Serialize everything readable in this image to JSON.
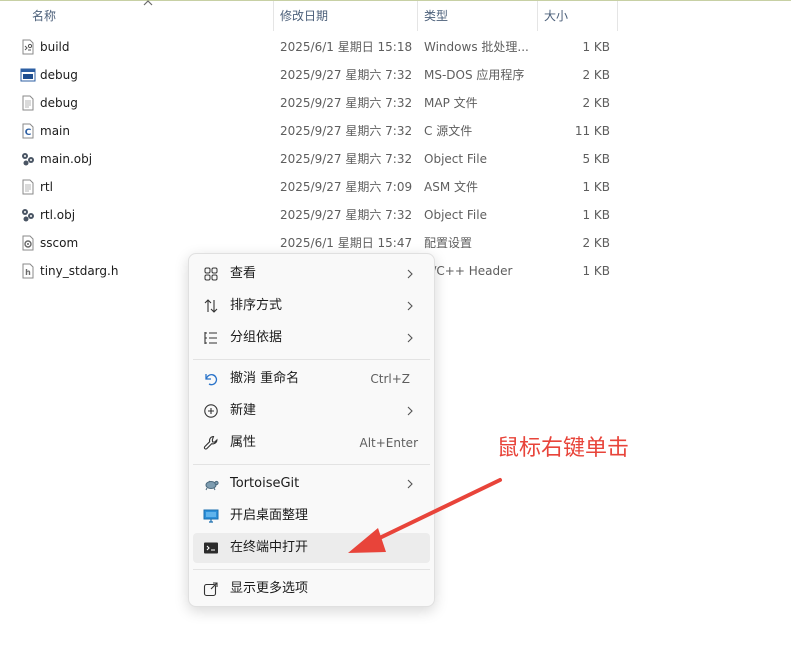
{
  "columns": {
    "name": "名称",
    "date": "修改日期",
    "type": "类型",
    "size": "大小"
  },
  "files": [
    {
      "name": "build",
      "date": "2025/6/1 星期日 15:18",
      "type": "Windows 批处理...",
      "size": "1 KB",
      "icon": "batch-file-icon"
    },
    {
      "name": "debug",
      "date": "2025/9/27 星期六 7:32",
      "type": "MS-DOS 应用程序",
      "size": "2 KB",
      "icon": "dos-app-icon"
    },
    {
      "name": "debug",
      "date": "2025/9/27 星期六 7:32",
      "type": "MAP 文件",
      "size": "2 KB",
      "icon": "generic-file-icon"
    },
    {
      "name": "main",
      "date": "2025/9/27 星期六 7:32",
      "type": "C 源文件",
      "size": "11 KB",
      "icon": "c-source-icon"
    },
    {
      "name": "main.obj",
      "date": "2025/9/27 星期六 7:32",
      "type": "Object File",
      "size": "5 KB",
      "icon": "object-file-icon"
    },
    {
      "name": "rtl",
      "date": "2025/9/27 星期六 7:09",
      "type": "ASM 文件",
      "size": "1 KB",
      "icon": "generic-file-icon"
    },
    {
      "name": "rtl.obj",
      "date": "2025/9/27 星期六 7:32",
      "type": "Object File",
      "size": "1 KB",
      "icon": "object-file-icon"
    },
    {
      "name": "sscom",
      "date": "2025/6/1 星期日 15:47",
      "type": "配置设置",
      "size": "2 KB",
      "icon": "config-file-icon"
    },
    {
      "name": "tiny_stdarg.h",
      "date": "",
      "type": "C/C++ Header",
      "size": "1 KB",
      "icon": "header-file-icon"
    }
  ],
  "menu": {
    "view": "查看",
    "sort": "排序方式",
    "group": "分组依据",
    "undo": "撤消 重命名",
    "undo_shortcut": "Ctrl+Z",
    "new": "新建",
    "properties": "属性",
    "properties_shortcut": "Alt+Enter",
    "tortoisegit": "TortoiseGit",
    "desktop_organizer": "开启桌面整理",
    "open_terminal": "在终端中打开",
    "more_options": "显示更多选项"
  },
  "annotation": {
    "text": "鼠标右键单击",
    "color": "#e8443a"
  }
}
